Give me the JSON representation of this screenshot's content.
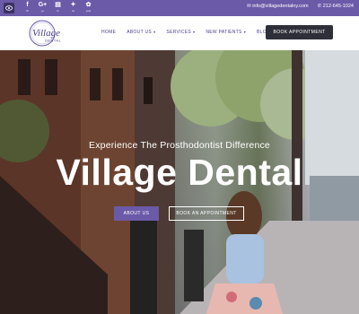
{
  "topbar": {
    "socials": [
      {
        "icon": "facebook-icon",
        "glyph": "f",
        "caption": "fb"
      },
      {
        "icon": "google-plus-icon",
        "glyph": "G+",
        "caption": "g+"
      },
      {
        "icon": "foursquare-icon",
        "glyph": "▤",
        "caption": "fs"
      },
      {
        "icon": "twitter-icon",
        "glyph": "✦",
        "caption": "tw"
      },
      {
        "icon": "yelp-icon",
        "glyph": "✿",
        "caption": "yelp"
      }
    ],
    "email": "info@villagedentalny.com",
    "phone": "212-645-1024"
  },
  "header": {
    "logo_text": "Village",
    "logo_subtext": "DENTAL",
    "nav": [
      {
        "label": "HOME",
        "has_caret": false
      },
      {
        "label": "ABOUT US",
        "has_caret": true
      },
      {
        "label": "SERVICES",
        "has_caret": true
      },
      {
        "label": "NEW PATIENTS",
        "has_caret": true
      },
      {
        "label": "BLOG",
        "has_caret": false
      }
    ],
    "book_button": "BOOK APPOINTMENT"
  },
  "hero": {
    "tagline": "Experience The Prosthodontist Difference",
    "title": "Village Dental",
    "cta_primary": "ABOUT US",
    "cta_secondary": "BOOK AN APPOINTMENT"
  },
  "colors": {
    "brand_purple": "#6b5aa8",
    "dark_button": "#2f2f3a"
  }
}
